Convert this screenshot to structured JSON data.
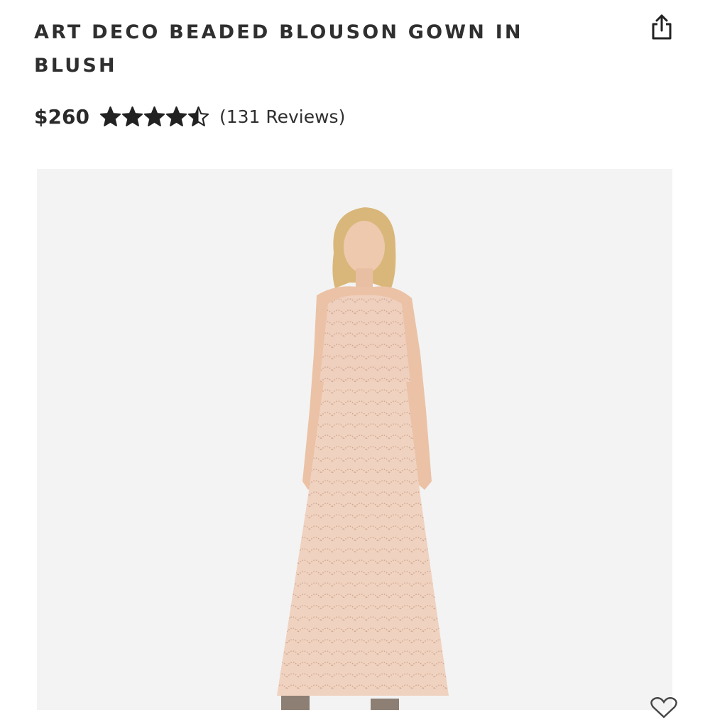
{
  "product": {
    "title": "ART DECO BEADED BLOUSON GOWN IN BLUSH",
    "price": "$260",
    "rating": 4.5,
    "rating_max": 5,
    "reviews_label": "(131 Reviews)"
  },
  "icons": {
    "share": "share-icon",
    "star": "star-icon",
    "favorite": "heart-icon"
  },
  "colors": {
    "text": "#2b2b2b",
    "image_background": "#f3f3f3",
    "dress": "#efcfbd"
  }
}
